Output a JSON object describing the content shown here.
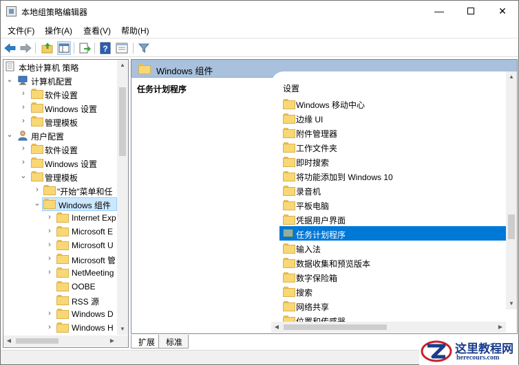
{
  "window": {
    "title": "本地组策略编辑器",
    "controls": {
      "minimize": "—",
      "maximize": "",
      "close": "✕"
    }
  },
  "menu": [
    "文件(F)",
    "操作(A)",
    "查看(V)",
    "帮助(H)"
  ],
  "toolbar": {
    "icons": [
      "back-arrow-icon",
      "forward-arrow-icon",
      "up-folder-icon",
      "show-hide-tree-icon",
      "export-list-icon",
      "help-icon",
      "extended-view-icon",
      "filter-icon"
    ]
  },
  "tree": {
    "root": "本地计算机 策略",
    "computer_config": "计算机配置",
    "cc_software": "软件设置",
    "cc_windows": "Windows 设置",
    "cc_admin": "管理模板",
    "user_config": "用户配置",
    "uc_software": "软件设置",
    "uc_windows": "Windows 设置",
    "uc_admin": "管理模板",
    "start_menu": "\"开始\"菜单和任",
    "windows_components": "Windows 组件",
    "children": [
      "Internet Exp",
      "Microsoft E",
      "Microsoft U",
      "Microsoft 管",
      "NetMeeting",
      "OOBE",
      "RSS 源",
      "Windows D",
      "Windows H"
    ]
  },
  "right": {
    "header": "Windows 组件",
    "description_title": "任务计划程序",
    "column_header": "设置",
    "items": [
      {
        "label": "Windows 移动中心",
        "selected": false,
        "icon": "folder-icon"
      },
      {
        "label": "边缘 UI",
        "selected": false,
        "icon": "folder-icon"
      },
      {
        "label": "附件管理器",
        "selected": false,
        "icon": "folder-icon"
      },
      {
        "label": "工作文件夹",
        "selected": false,
        "icon": "folder-icon"
      },
      {
        "label": "即时搜索",
        "selected": false,
        "icon": "folder-icon"
      },
      {
        "label": "将功能添加到 Windows 10",
        "selected": false,
        "icon": "folder-icon"
      },
      {
        "label": "录音机",
        "selected": false,
        "icon": "folder-icon"
      },
      {
        "label": "平板电脑",
        "selected": false,
        "icon": "folder-icon"
      },
      {
        "label": "凭据用户界面",
        "selected": false,
        "icon": "folder-icon"
      },
      {
        "label": "任务计划程序",
        "selected": true,
        "icon": "policy-folder-icon"
      },
      {
        "label": "输入法",
        "selected": false,
        "icon": "folder-icon"
      },
      {
        "label": "数据收集和预览版本",
        "selected": false,
        "icon": "folder-icon"
      },
      {
        "label": "数字保险箱",
        "selected": false,
        "icon": "folder-icon"
      },
      {
        "label": "搜索",
        "selected": false,
        "icon": "folder-icon"
      },
      {
        "label": "网络共享",
        "selected": false,
        "icon": "folder-icon"
      },
      {
        "label": "位置和传感器",
        "selected": false,
        "icon": "folder-icon"
      }
    ]
  },
  "tabs": [
    "扩展",
    "标准"
  ],
  "watermark": {
    "cn": "这里教程网",
    "en": "herecours.com"
  },
  "colors": {
    "selection": "#0078d7",
    "header_band": "#a9c1dc",
    "folder": "#f8d775"
  }
}
